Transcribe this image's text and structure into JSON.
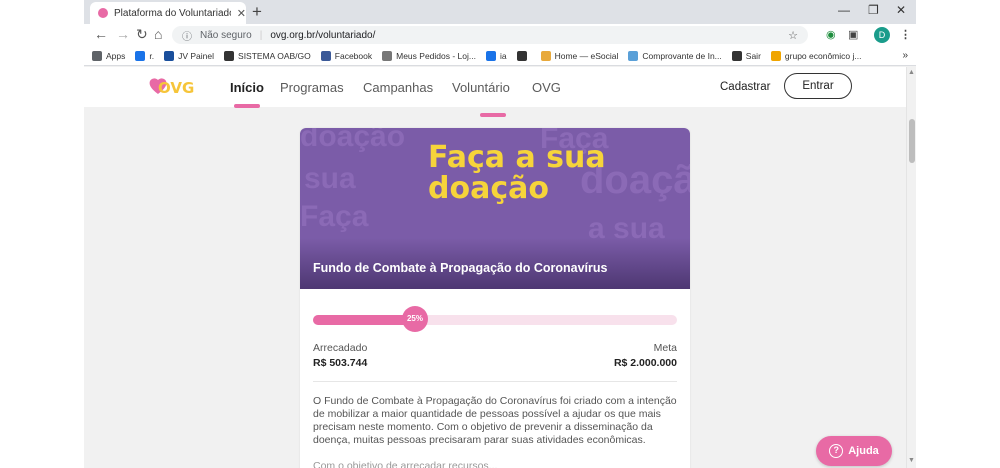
{
  "browser": {
    "tab_title": "Plataforma do Voluntariado - Ad",
    "tab_close": "✕",
    "new_tab": "+",
    "window_controls": [
      "—",
      "❐",
      "✕"
    ],
    "security_label": "Não seguro",
    "url": "ovg.org.br/voluntariado/",
    "profile_initial": "D",
    "bookmarks": [
      {
        "label": "Apps",
        "color": "#5f6368"
      },
      {
        "label": "r.",
        "color": "#1a73e8"
      },
      {
        "label": "JV Painel",
        "color": "#1a4f9c"
      },
      {
        "label": "SISTEMA OAB/GO",
        "color": "#333333"
      },
      {
        "label": "Facebook",
        "color": "#3b5998"
      },
      {
        "label": "Meus Pedidos - Loj...",
        "color": "#777777"
      },
      {
        "label": "ia",
        "color": "#1a73e8"
      },
      {
        "label": "",
        "color": "#333333"
      },
      {
        "label": "Home — eSocial",
        "color": "#e8a93b"
      },
      {
        "label": "Comprovante de In...",
        "color": "#5aa0d8"
      },
      {
        "label": "Sair",
        "color": "#333333"
      },
      {
        "label": "grupo econômico j...",
        "color": "#f0a500"
      }
    ],
    "bookmarks_more": "»"
  },
  "site": {
    "logo_text": "OVG",
    "menu": [
      "Início",
      "Programas",
      "Campanhas",
      "Voluntário",
      "OVG"
    ],
    "signup_label": "Cadastrar",
    "login_label": "Entrar"
  },
  "campaign": {
    "hero_text": "Faça a sua doação",
    "hero_bg_words": [
      "doação",
      "Faça",
      "sua",
      "doação",
      "Faça",
      "a sua"
    ],
    "title": "Fundo de Combate à Propagação do Coronavírus",
    "progress": 0.25,
    "progress_label": "25%",
    "raised_label": "Arrecadado",
    "raised_value": "R$ 503.744",
    "goal_label": "Meta",
    "goal_value": "R$ 2.000.000",
    "description": "O Fundo de Combate à Propagação do Coronavírus foi criado com a intenção de mobilizar a maior quantidade de pessoas possível a ajudar os que mais precisam neste momento. Com o objetivo de prevenir a disseminação da doença, muitas pessoas precisaram parar suas atividades econômicas.",
    "description_cont": "Com o objetivo de arrecadar recursos..."
  },
  "help": {
    "label": "Ajuda",
    "icon": "?"
  },
  "colors": {
    "brand_pink": "#e86aa5",
    "hero_purple": "#7b5ca8",
    "hero_yellow": "#f6d43a"
  }
}
